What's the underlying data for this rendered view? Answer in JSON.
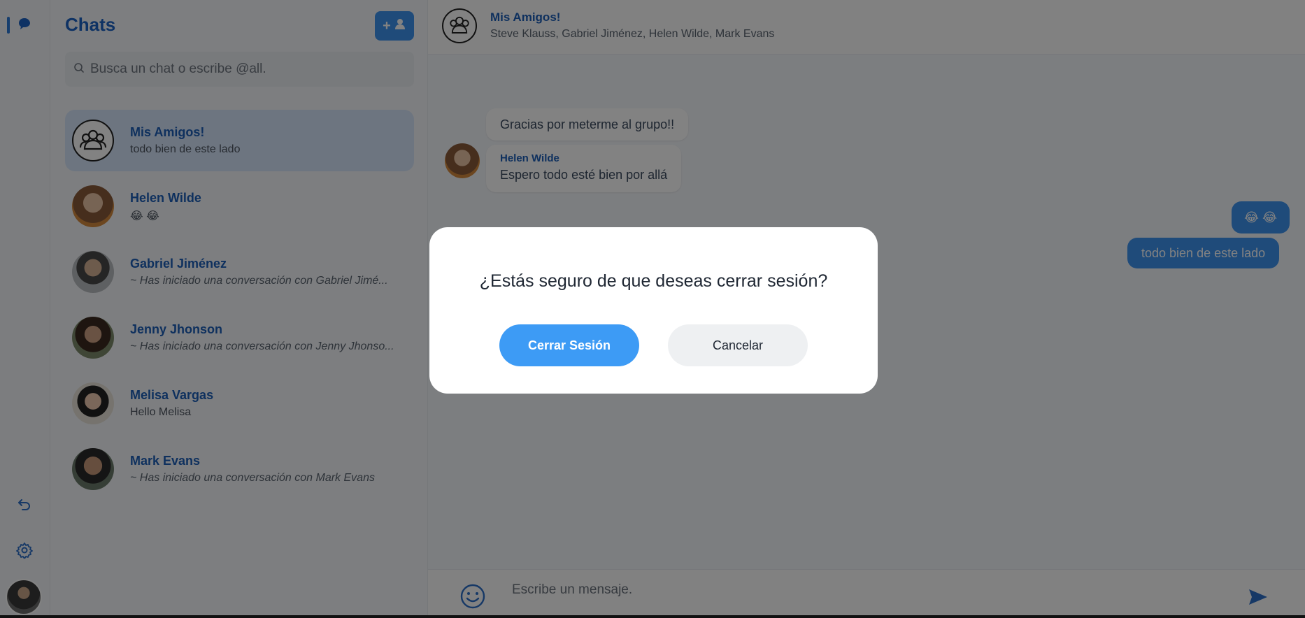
{
  "sidebar": {
    "icons": [
      "chat-icon",
      "logout-icon",
      "settings-icon"
    ]
  },
  "chats_panel": {
    "title": "Chats",
    "new_chat_label": "+",
    "search_placeholder": "Busca un chat o escribe @all.",
    "items": [
      {
        "name": "Mis Amigos!",
        "preview": "todo bien de este lado",
        "active": true
      },
      {
        "name": "Helen Wilde",
        "preview": "😂 😂"
      },
      {
        "name": "Gabriel Jiménez",
        "preview": "~ Has iniciado una conversación con Gabriel Jimé..."
      },
      {
        "name": "Jenny Jhonson",
        "preview": "~ Has iniciado una conversación con Jenny Jhonso..."
      },
      {
        "name": "Melisa Vargas",
        "preview": "Hello Melisa"
      },
      {
        "name": "Mark Evans",
        "preview": "~ Has iniciado una conversación con Mark Evans"
      }
    ]
  },
  "chat": {
    "title": "Mis Amigos!",
    "members": "Steve Klauss, Gabriel Jiménez, Helen Wilde, Mark Evans",
    "messages": [
      {
        "text": "Gracias por meterme al grupo!!"
      },
      {
        "author": "Helen Wilde",
        "text": "Espero todo esté bien por allá"
      },
      {
        "text": "😂 😂"
      },
      {
        "text": "todo bien de este lado"
      }
    ],
    "composer_placeholder": "Escribe un mensaje."
  },
  "dialog": {
    "title": "¿Estás seguro de que deseas cerrar sesión?",
    "confirm_label": "Cerrar Sesión",
    "cancel_label": "Cancelar"
  },
  "colors": {
    "accent": "#3d93f0",
    "brand_text": "#1d5fb8",
    "active_chat_bg": "#d6e6fb"
  }
}
